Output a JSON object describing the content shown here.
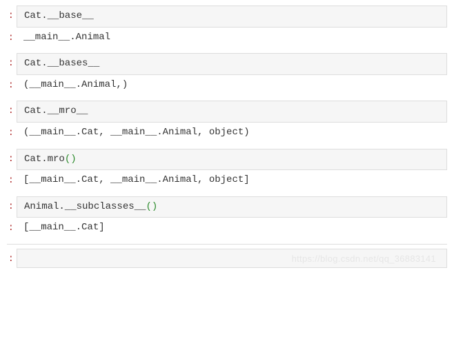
{
  "cells": [
    {
      "input_plain": "Cat.__base__",
      "input_paren": "",
      "output": "__main__.Animal"
    },
    {
      "input_plain": "Cat.__bases__",
      "input_paren": "",
      "output": "(__main__.Animal,)"
    },
    {
      "input_plain": "Cat.__mro__",
      "input_paren": "",
      "output": "(__main__.Cat, __main__.Animal, object)"
    },
    {
      "input_plain": "Cat.mro",
      "input_paren": "()",
      "output": "[__main__.Cat, __main__.Animal, object]"
    },
    {
      "input_plain": "Animal.__subclasses__",
      "input_paren": "()",
      "output": "[__main__.Cat]"
    }
  ],
  "empty_cell_input": "",
  "watermark": "https://blog.csdn.net/qq_36883141",
  "prompt_char": ":"
}
